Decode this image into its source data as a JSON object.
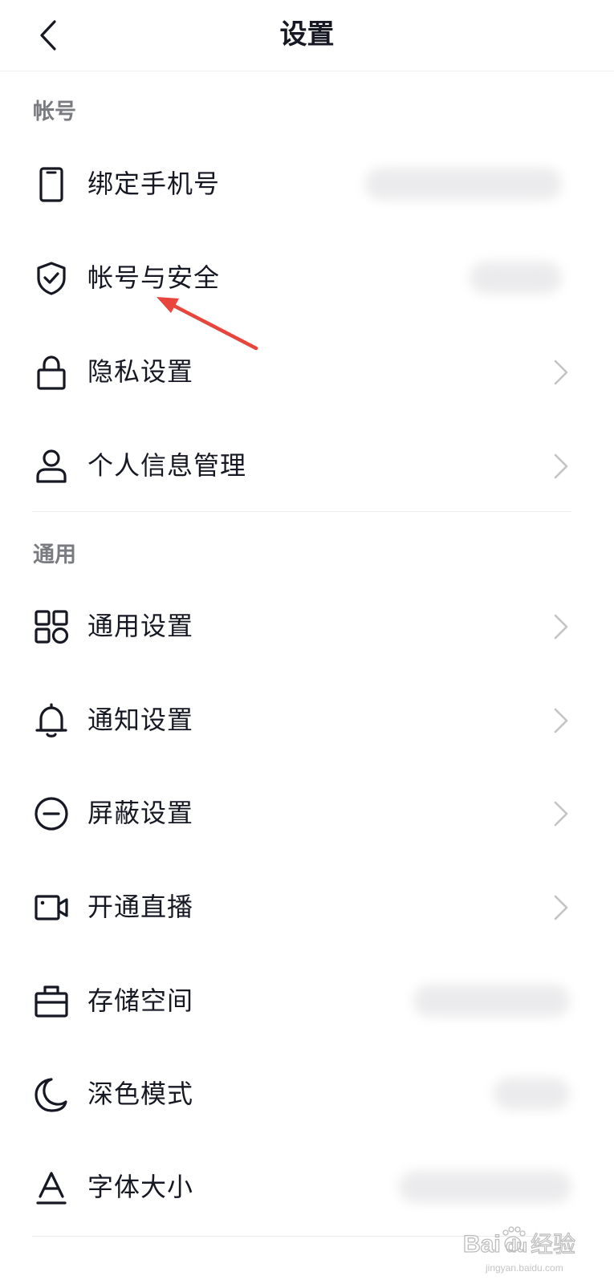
{
  "header": {
    "title": "设置",
    "back_icon": "chevron-left-icon"
  },
  "sections": {
    "account": {
      "title": "帐号",
      "items": [
        {
          "label": "绑定手机号",
          "icon": "phone-icon",
          "value": "blurred"
        },
        {
          "label": "帐号与安全",
          "icon": "shield-check-icon",
          "value": "blurred"
        },
        {
          "label": "隐私设置",
          "icon": "lock-icon"
        },
        {
          "label": "个人信息管理",
          "icon": "user-icon"
        }
      ]
    },
    "general": {
      "title": "通用",
      "items": [
        {
          "label": "通用设置",
          "icon": "grid-icon"
        },
        {
          "label": "通知设置",
          "icon": "bell-icon"
        },
        {
          "label": "屏蔽设置",
          "icon": "block-icon"
        },
        {
          "label": "开通直播",
          "icon": "video-camera-icon"
        },
        {
          "label": "存储空间",
          "icon": "storage-icon",
          "value": "blurred"
        },
        {
          "label": "深色模式",
          "icon": "moon-icon",
          "value": "blurred"
        },
        {
          "label": "字体大小",
          "icon": "font-size-icon",
          "value": "blurred"
        }
      ]
    }
  },
  "colors": {
    "text_primary": "#161823",
    "section_title": "#7a7b80",
    "chevron": "#c4c4c6",
    "annotation_arrow": "#e8453c"
  },
  "watermark": {
    "brand": "Bai",
    "brand_suffix": "du",
    "service": "经验",
    "url": "jingyan.baidu.com"
  }
}
